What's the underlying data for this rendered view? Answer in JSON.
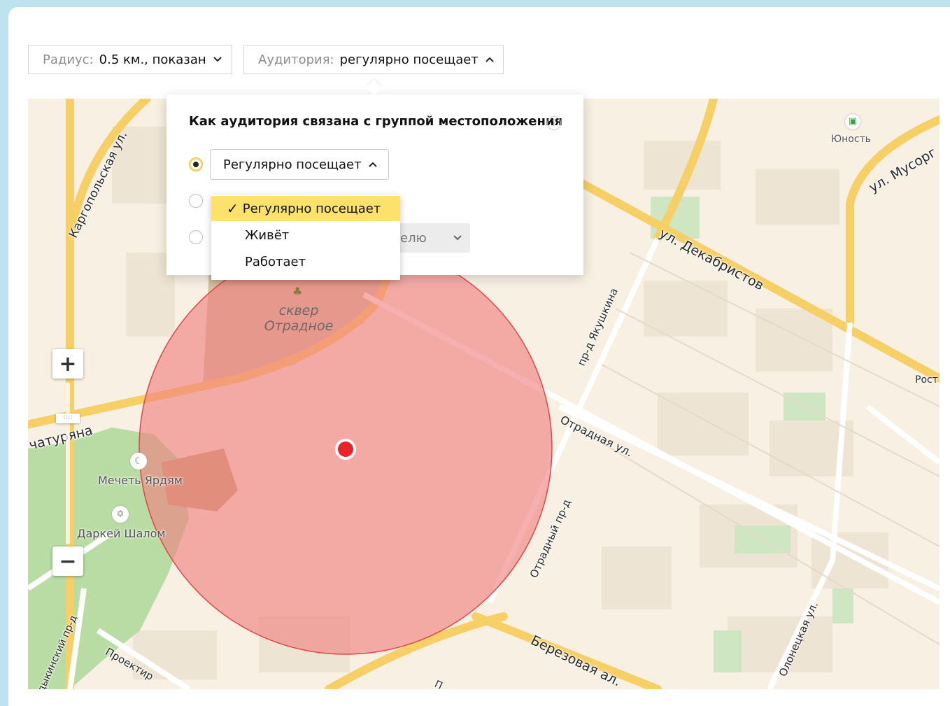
{
  "toolbar": {
    "radius": {
      "label": "Радиус:",
      "value": "0.5 км., показан"
    },
    "audience": {
      "label": "Аудитория:",
      "value": "регулярно посещает"
    }
  },
  "popup": {
    "title": "Как аудитория связана с группой местоположения",
    "help": "?",
    "selected_option": "Регулярно посещает",
    "partial_select_text": "елю",
    "radio_options_count": 3
  },
  "dropdown": {
    "items": [
      {
        "label": "Регулярно посещает",
        "selected": true
      },
      {
        "label": "Живёт",
        "selected": false
      },
      {
        "label": "Работает",
        "selected": false
      }
    ],
    "check_mark": "✓"
  },
  "map": {
    "streets": [
      "Каргопольская ул.",
      "ул. Декабристов",
      "ул. Мусорг",
      "пр-д Якушкина",
      "Отрадная ул.",
      "Отрадный пр-д",
      "Березовая ал.",
      "Олонецкая ул.",
      "чатуряна",
      "дыкинский пр-д",
      "Проектир",
      "Рост",
      "П"
    ],
    "pois": [
      "Юность",
      "Мечеть Ярдям",
      "Даркей Шалом"
    ],
    "park": {
      "line1": "сквер",
      "line2": "Отрадное"
    },
    "circle_color": "#f08080",
    "marker_color": "#e8232b",
    "zoom": {
      "in": "+",
      "out": "−",
      "thumb": "::::"
    }
  }
}
